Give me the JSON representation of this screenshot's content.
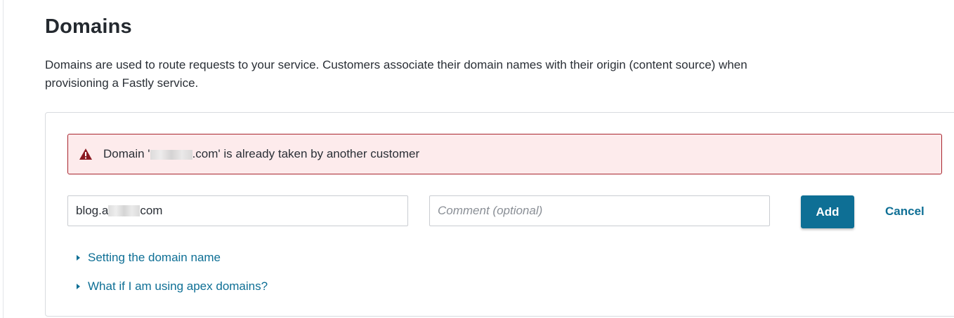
{
  "page": {
    "title": "Domains",
    "description": "Domains are used to route requests to your service. Customers associate their domain names with their origin (content source) when provisioning a Fastly service."
  },
  "alert": {
    "icon": "warning-triangle-icon",
    "color": "#a8242d",
    "prefix": "Domain '",
    "suffix": ".com' is already taken by another customer"
  },
  "form": {
    "domain_prefix": "blog.a",
    "domain_suffix": "com",
    "comment_placeholder": "Comment (optional)",
    "comment_value": "",
    "add_label": "Add",
    "cancel_label": "Cancel"
  },
  "help_links": [
    {
      "label": "Setting the domain name"
    },
    {
      "label": "What if I am using apex domains?"
    }
  ],
  "colors": {
    "accent": "#0e6f95",
    "error_border": "#a8242d",
    "error_background": "#fdebec"
  }
}
